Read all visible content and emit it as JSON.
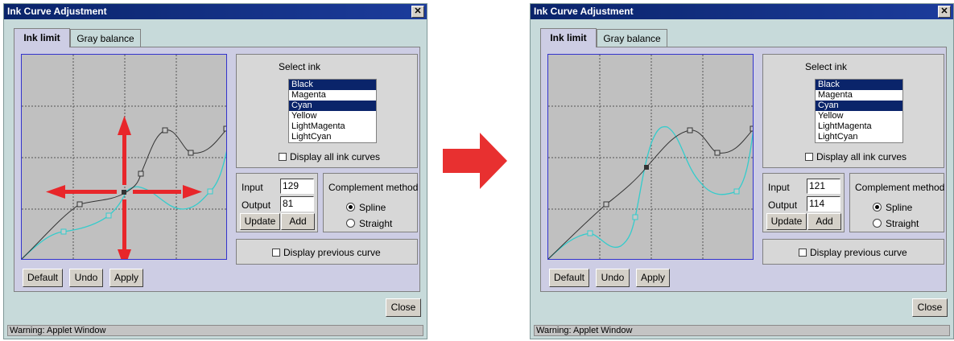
{
  "windows": [
    {
      "title": "Ink Curve Adjustment",
      "close_symbol": "✕",
      "tabs": [
        "Ink limit",
        "Gray balance"
      ],
      "select_ink_label": "Select ink",
      "inks": [
        "Black",
        "Magenta",
        "Cyan",
        "Yellow",
        "LightMagenta",
        "LightCyan"
      ],
      "selected_inks": [
        0,
        2
      ],
      "display_all_label": "Display all ink curves",
      "input_label": "Input",
      "input_value": "129",
      "output_label": "Output",
      "output_value": "81",
      "update_label": "Update",
      "add_label": "Add",
      "complement_label": "Complement method",
      "spline_label": "Spline",
      "straight_label": "Straight",
      "complement_selected": "Spline",
      "display_prev_label": "Display previous curve",
      "default_label": "Default",
      "undo_label": "Undo",
      "apply_label": "Apply",
      "close_label": "Close",
      "status": "Warning: Applet Window"
    },
    {
      "title": "Ink Curve Adjustment",
      "close_symbol": "✕",
      "tabs": [
        "Ink limit",
        "Gray balance"
      ],
      "select_ink_label": "Select ink",
      "inks": [
        "Black",
        "Magenta",
        "Cyan",
        "Yellow",
        "LightMagenta",
        "LightCyan"
      ],
      "selected_inks": [
        0,
        2
      ],
      "display_all_label": "Display all ink curves",
      "input_label": "Input",
      "input_value": "121",
      "output_label": "Output",
      "output_value": "114",
      "update_label": "Update",
      "add_label": "Add",
      "complement_label": "Complement method",
      "spline_label": "Spline",
      "straight_label": "Straight",
      "complement_selected": "Spline",
      "display_prev_label": "Display previous curve",
      "default_label": "Default",
      "undo_label": "Undo",
      "apply_label": "Apply",
      "close_label": "Close",
      "status": "Warning: Applet Window"
    }
  ],
  "colors": {
    "titlebar": "#0a246a",
    "selection": "#0a246a",
    "black_curve": "#333333",
    "cyan_curve": "#33cccc",
    "drag_arrows": "#e8262a",
    "transition_arrow": "#e83030"
  },
  "icons": {
    "transition": "right-arrow-icon",
    "drag": "four-way-move-arrows-icon"
  }
}
